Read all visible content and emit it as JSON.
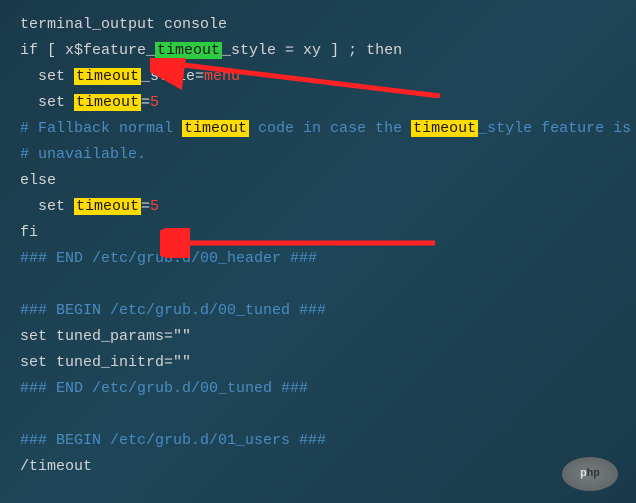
{
  "lines": {
    "l1_a": "terminal_output console",
    "l2_a": "if [ x$feature_",
    "l2_hl": "timeout",
    "l2_b": "_style = xy ] ; then",
    "l3_a": "set ",
    "l3_hl": "timeout",
    "l3_b": "_style=",
    "l3_red": "menu",
    "l4_a": "set ",
    "l4_hl": "timeout",
    "l4_b": "=",
    "l4_red": "5",
    "l5_a": "# Fallback normal ",
    "l5_hl1": "timeout",
    "l5_b": " code in case the ",
    "l5_hl2": "timeout",
    "l5_c": "_style feature is",
    "l6": "# unavailable.",
    "l7": "else",
    "l8_a": "set ",
    "l8_hl": "timeout",
    "l8_b": "=",
    "l8_red": "5",
    "l9": "fi",
    "l10": "### END /etc/grub.d/00_header ###",
    "l11": "",
    "l12": "### BEGIN /etc/grub.d/00_tuned ###",
    "l13_a": "set tuned_params=",
    "l13_b": "\"\"",
    "l14_a": "set tuned_initrd=",
    "l14_b": "\"\"",
    "l15": "### END /etc/grub.d/00_tuned ###",
    "l16": "",
    "l17": "### BEGIN /etc/grub.d/01_users ###",
    "l18": "/timeout"
  },
  "logo": {
    "text1": "p",
    "text2": "hp"
  }
}
